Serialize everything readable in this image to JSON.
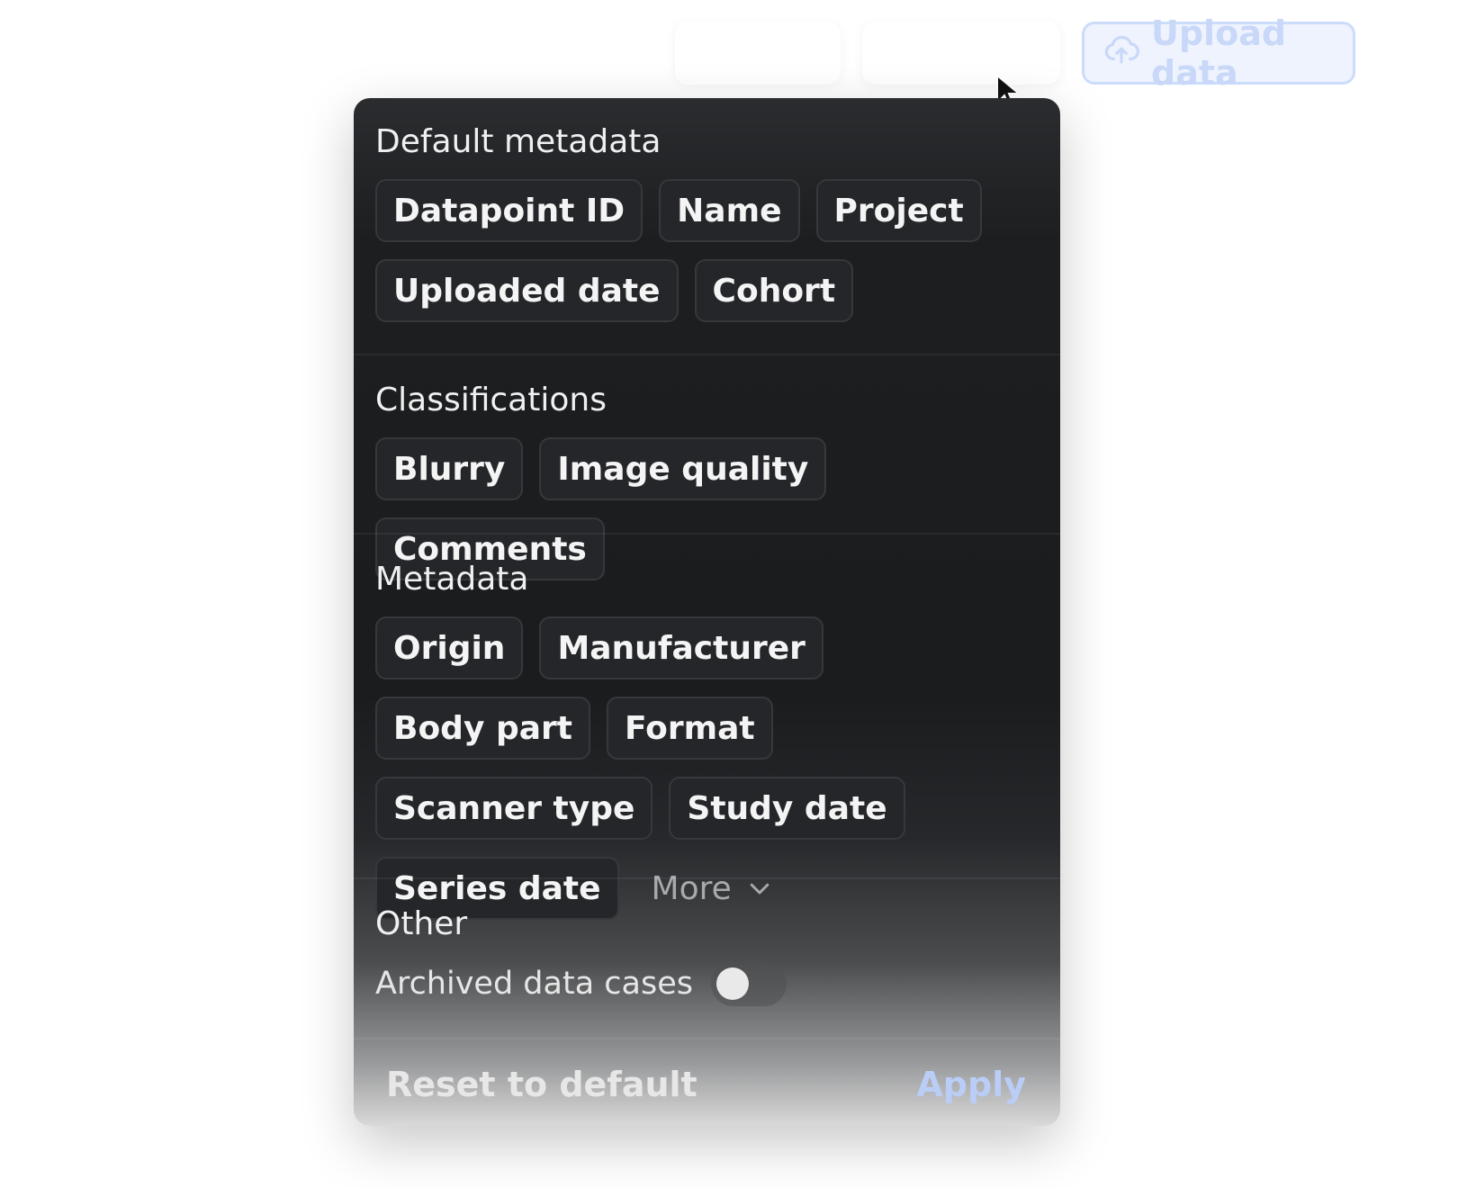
{
  "toolbar": {
    "upload_label": "Upload data",
    "upload_icon": "cloud-upload-icon"
  },
  "panel": {
    "sections": [
      {
        "title": "Default metadata",
        "chips": [
          "Datapoint ID",
          "Name",
          "Project",
          "Uploaded date",
          "Cohort"
        ]
      },
      {
        "title": "Classifications",
        "chips": [
          "Blurry",
          "Image quality",
          "Comments"
        ]
      },
      {
        "title": "Metadata",
        "chips": [
          "Origin",
          "Manufacturer",
          "Body part",
          "Format",
          "Scanner type",
          "Study date",
          "Series date"
        ],
        "more_label": "More",
        "more_icon": "chevron-down-icon"
      },
      {
        "title": "Other",
        "toggle_label": "Archived data cases",
        "toggle_on": false
      }
    ],
    "footer": {
      "reset_label": "Reset to default",
      "apply_label": "Apply"
    }
  },
  "colors": {
    "panel_bg": "#1a1c1e",
    "chip_bg": "#24262a",
    "apply_accent": "#b9cdf6",
    "upload_accent": "#cbdcfb"
  }
}
